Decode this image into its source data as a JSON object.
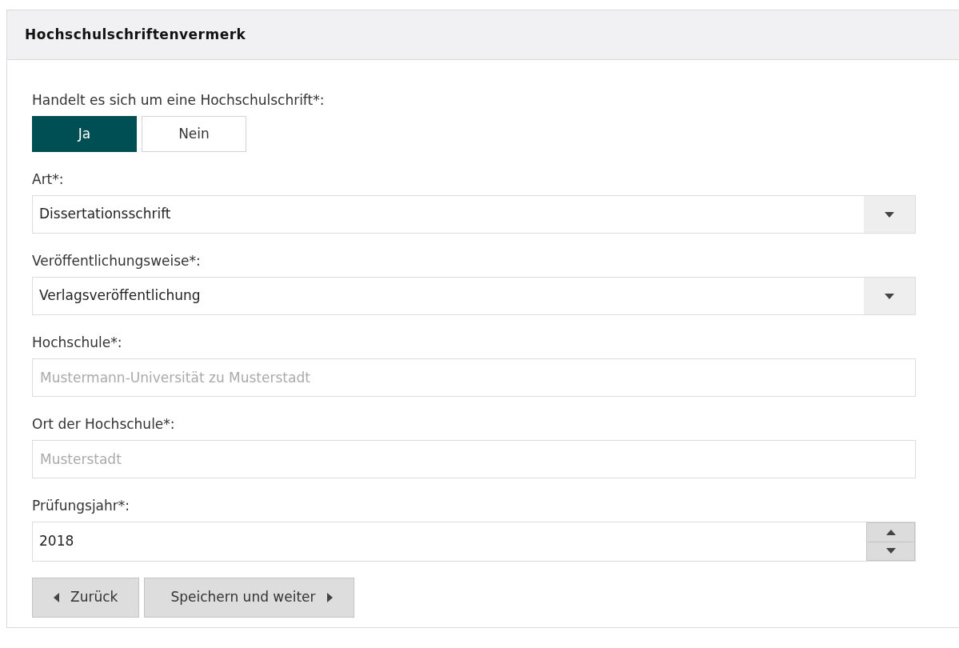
{
  "panel": {
    "title": "Hochschulschriftenvermerk"
  },
  "question": {
    "label": "Handelt es sich um eine Hochschulschrift*:",
    "options": [
      {
        "label": "Ja",
        "selected": true
      },
      {
        "label": "Nein",
        "selected": false
      }
    ]
  },
  "fields": [
    {
      "kind": "select",
      "label": "Art*:",
      "value": "Dissertationsschrift"
    },
    {
      "kind": "select",
      "label": "Veröffentlichungsweise*:",
      "value": "Verlagsveröffentlichung"
    },
    {
      "kind": "text",
      "label": "Hochschule*:",
      "placeholder": "Mustermann-Universität zu Musterstadt"
    },
    {
      "kind": "text",
      "label": "Ort der Hochschule*:",
      "placeholder": "Musterstadt"
    },
    {
      "kind": "number",
      "label": "Prüfungsjahr*:",
      "value": "2018"
    }
  ],
  "buttons": [
    {
      "kind": "back",
      "label": "Zurück"
    },
    {
      "kind": "next",
      "label": "Speichern und weiter"
    }
  ]
}
